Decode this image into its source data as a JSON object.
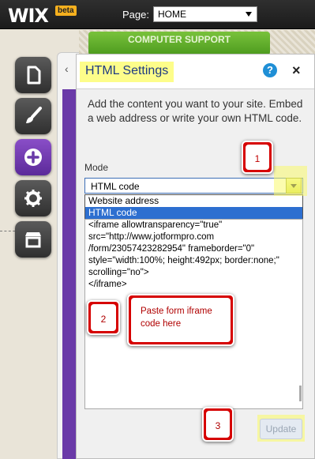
{
  "topbar": {
    "logo": "WIX",
    "logo_badge": "beta",
    "page_label": "Page:",
    "page_select_value": "HOME"
  },
  "background": {
    "banner_text": "COMPUTER SUPPORT"
  },
  "rail": {
    "items": [
      {
        "icon": "page-icon"
      },
      {
        "icon": "brush-icon"
      },
      {
        "icon": "add-icon",
        "active": true
      },
      {
        "icon": "gear-icon"
      },
      {
        "icon": "store-icon"
      }
    ]
  },
  "dialog": {
    "title": "HTML Settings",
    "help_glyph": "?",
    "close_glyph": "×",
    "intro": "Add the content you want to your site. Embed a web address or write your own HTML code.",
    "mode_label": "Mode",
    "mode_value": "HTML code",
    "mode_options": [
      "Website address",
      "HTML code"
    ],
    "code": "<iframe allowtransparency=\"true\"\nsrc=\"http://www.jotformpro.com\n/form/23057423282954\" frameborder=\"0\"\nstyle=\"width:100%; height:492px; border:none;\"\nscrolling=\"no\">\n</iframe>",
    "update_label": "Update"
  },
  "annotations": {
    "one": "1",
    "two": "2",
    "three": "3",
    "paste_note": "Paste form iframe code here"
  },
  "colors": {
    "accent_purple": "#6a3aa8",
    "title_text": "#1f3a82",
    "highlight_yellow": "#fdfd8a",
    "annotation_red": "#d60000",
    "selected_option": "#2d6fd0"
  }
}
